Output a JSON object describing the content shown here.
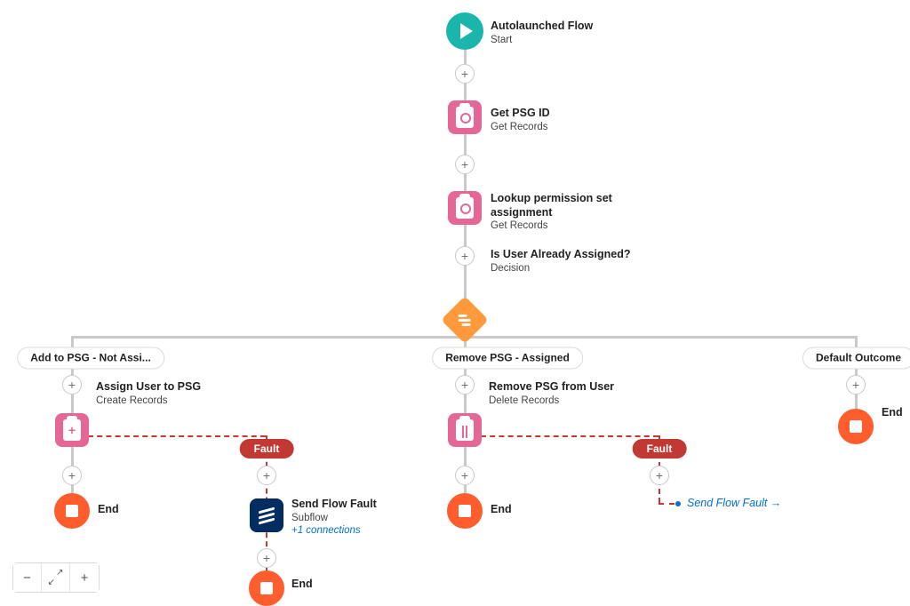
{
  "flow": {
    "start": {
      "title": "Autolaunched Flow",
      "sub": "Start"
    },
    "get_psg": {
      "title": "Get PSG ID",
      "sub": "Get Records"
    },
    "lookup_psa": {
      "title": "Lookup permission set assignment",
      "sub": "Get Records"
    },
    "decision": {
      "title": "Is User Already Assigned?",
      "sub": "Decision"
    },
    "outcome_left": "Add to PSG - Not Assi...",
    "outcome_mid": "Remove PSG - Assigned",
    "outcome_right": "Default Outcome",
    "assign_user": {
      "title": "Assign User to PSG",
      "sub": "Create Records"
    },
    "remove_psg": {
      "title": "Remove PSG from User",
      "sub": "Delete Records"
    },
    "fault_label": "Fault",
    "send_fault": {
      "title": "Send Flow Fault",
      "sub": "Subflow",
      "extra": "+1 connections"
    },
    "goto_label": "Send Flow Fault",
    "end_label": "End"
  },
  "toolbar": {
    "zoom_out": "−",
    "fit": "fit",
    "zoom_in": "+"
  }
}
